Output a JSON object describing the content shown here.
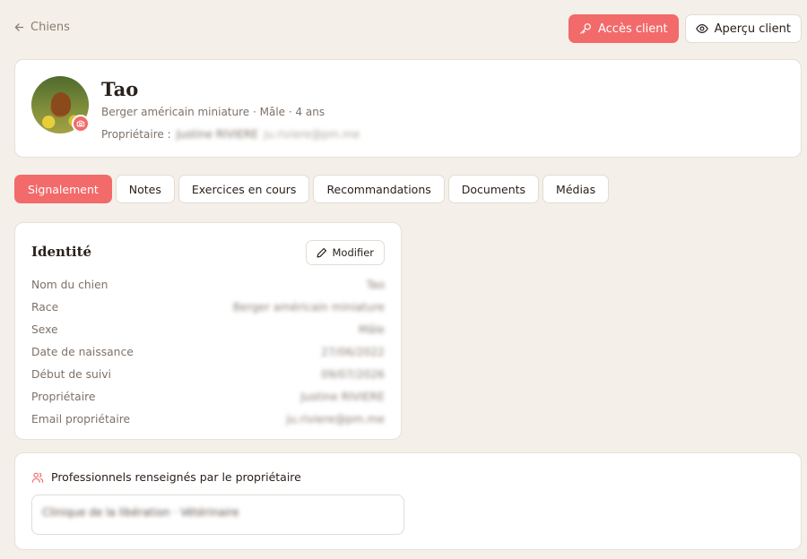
{
  "nav": {
    "back_label": "Chiens"
  },
  "actions": {
    "client_access": "Accès client",
    "client_preview": "Aperçu client"
  },
  "profile": {
    "name": "Tao",
    "meta": "Berger américain miniature · Mâle · 4 ans",
    "owner_label": "Propriétaire :",
    "owner_name": "Justine RIVIERE",
    "owner_email": "ju.riviere@pm.me"
  },
  "tabs": [
    {
      "label": "Signalement",
      "active": true
    },
    {
      "label": "Notes"
    },
    {
      "label": "Exercices en cours"
    },
    {
      "label": "Recommandations"
    },
    {
      "label": "Documents"
    },
    {
      "label": "Médias"
    }
  ],
  "identity": {
    "title": "Identité",
    "edit_label": "Modifier",
    "fields": [
      {
        "label": "Nom du chien",
        "value": "Tao"
      },
      {
        "label": "Race",
        "value": "Berger américain miniature"
      },
      {
        "label": "Sexe",
        "value": "Mâle"
      },
      {
        "label": "Date de naissance",
        "value": "27/06/2022"
      },
      {
        "label": "Début de suivi",
        "value": "09/07/2026"
      },
      {
        "label": "Propriétaire",
        "value": "Justine RIVIERE"
      },
      {
        "label": "Email propriétaire",
        "value": "ju.riviere@pm.me"
      }
    ]
  },
  "professionals": {
    "title": "Professionnels renseignés par le propriétaire",
    "items": [
      "Clinique de la libération · Vétérinaire"
    ]
  },
  "colors": {
    "accent": "#f36a6a",
    "background": "#f4f0e9",
    "card": "#ffffff"
  }
}
